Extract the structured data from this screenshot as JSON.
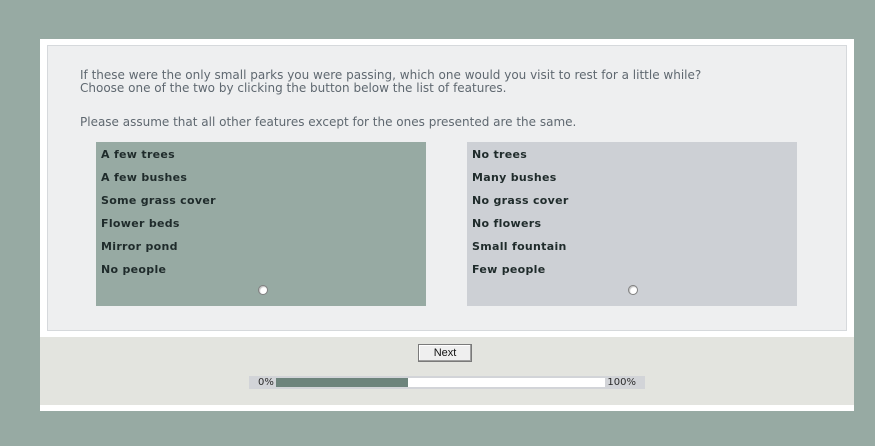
{
  "question": {
    "line1": "If these were the only small parks you were passing, which one would you visit to rest for a little while?",
    "line2": "Choose one of the two by clicking the button below the list of features.",
    "note": "Please assume that all other features except for the ones presented are the same."
  },
  "options": [
    {
      "features": [
        "A few trees",
        "A few bushes",
        "Some grass cover",
        "Flower beds",
        "Mirror pond",
        "No people"
      ],
      "selected": false
    },
    {
      "features": [
        "No trees",
        "Many bushes",
        "No grass cover",
        "No flowers",
        "Small fountain",
        "Few people"
      ],
      "selected": false
    }
  ],
  "next_label": "Next",
  "progress": {
    "start_label": "0%",
    "end_label": "100%",
    "fraction": 0.4
  },
  "colors": {
    "background": "#97aaa3",
    "option_left": "#97aaa3",
    "option_right": "#cdd0d5",
    "progress_fill": "#6d847c"
  }
}
